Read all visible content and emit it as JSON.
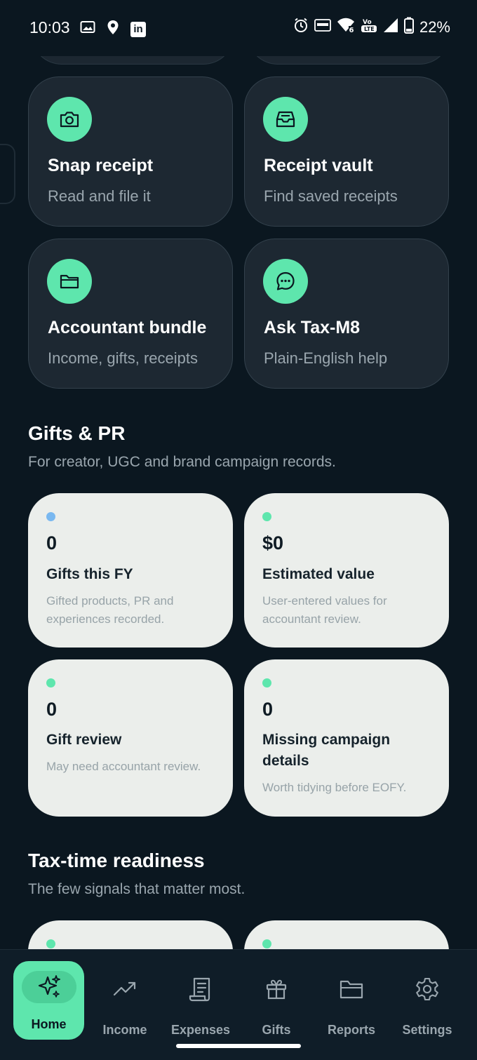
{
  "status_bar": {
    "time": "10:03",
    "battery": "22%",
    "icons_left": [
      "image-icon",
      "location-icon",
      "linkedin-icon"
    ],
    "icons_right": [
      "alarm-icon",
      "auto-icon",
      "wifi-6-icon",
      "volte-icon",
      "signal-icon",
      "battery-icon"
    ]
  },
  "quick_actions": [
    {
      "title": "Snap receipt",
      "subtitle": "Read and file it",
      "icon": "camera-icon"
    },
    {
      "title": "Receipt vault",
      "subtitle": "Find saved receipts",
      "icon": "inbox-icon"
    },
    {
      "title": "Accountant bundle",
      "subtitle": "Income, gifts, receipts",
      "icon": "folder-icon"
    },
    {
      "title": "Ask Tax-M8",
      "subtitle": "Plain-English help",
      "icon": "chat-icon"
    }
  ],
  "gifts_section": {
    "title": "Gifts & PR",
    "subtitle": "For creator, UGC and brand campaign records.",
    "cards": [
      {
        "value": "0",
        "label": "Gifts this FY",
        "desc": "Gifted products, PR and experiences recorded.",
        "dot_color": "#79b8f0"
      },
      {
        "value": "$0",
        "label": "Estimated value",
        "desc": "User-entered values for accountant review.",
        "dot_color": "#5ee6ad"
      },
      {
        "value": "0",
        "label": "Gift review",
        "desc": "May need accountant review.",
        "dot_color": "#5ee6ad"
      },
      {
        "value": "0",
        "label": "Missing campaign details",
        "desc": "Worth tidying before EOFY.",
        "dot_color": "#5ee6ad"
      }
    ]
  },
  "readiness_section": {
    "title": "Tax-time readiness",
    "subtitle": "The few signals that matter most."
  },
  "nav": {
    "items": [
      {
        "label": "Home",
        "icon": "sparkles-icon",
        "active": true
      },
      {
        "label": "Income",
        "icon": "trend-up-icon"
      },
      {
        "label": "Expenses",
        "icon": "receipt-icon"
      },
      {
        "label": "Gifts",
        "icon": "gift-icon"
      },
      {
        "label": "Reports",
        "icon": "folder-icon"
      },
      {
        "label": "Settings",
        "icon": "gear-icon"
      }
    ]
  },
  "colors": {
    "background": "#0b1720",
    "accent": "#5ee6ad",
    "dark_card": "#1d2832",
    "light_card": "#ebeeeb",
    "muted_text": "#9aa6ae"
  }
}
